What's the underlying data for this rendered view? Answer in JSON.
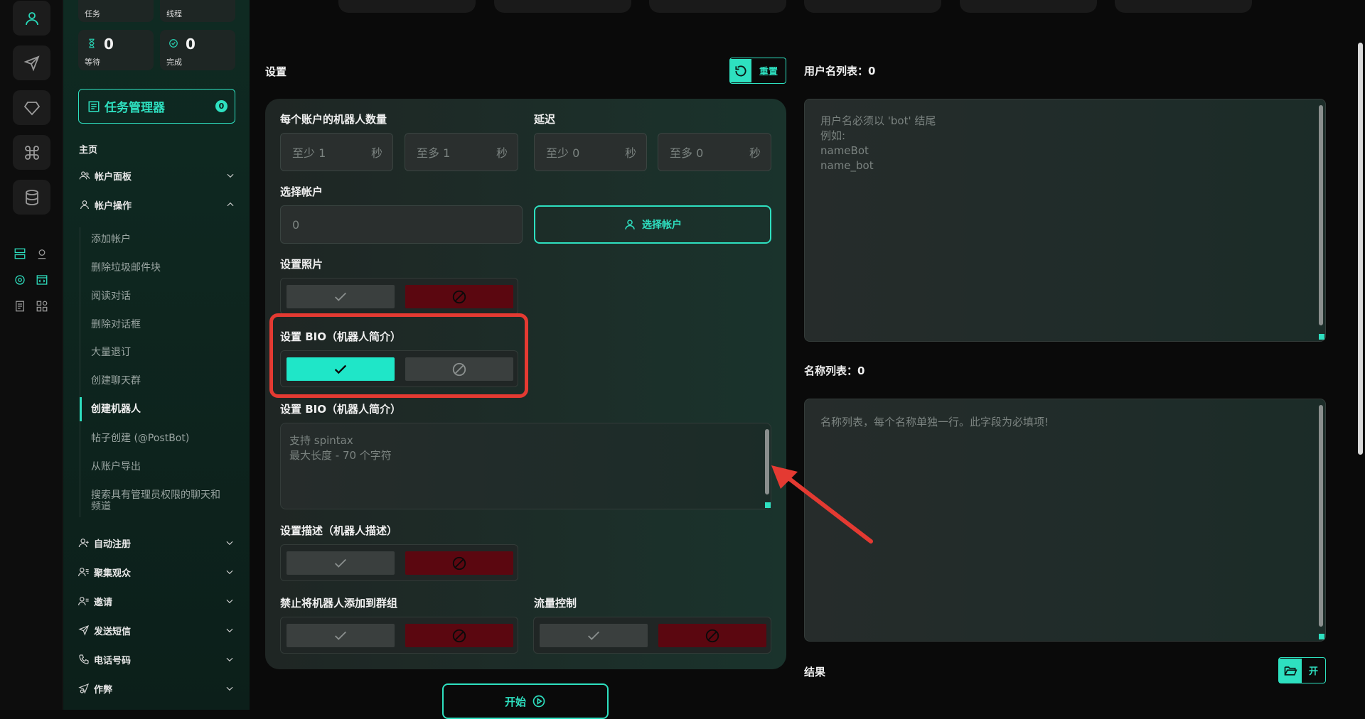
{
  "stats": {
    "tasks_label": "任务",
    "threads_label": "线程",
    "waiting_value": "0",
    "waiting_label": "等待",
    "done_value": "0",
    "done_label": "完成"
  },
  "sidebar": {
    "task_manager_label": "任务管理器",
    "task_manager_badge": "0",
    "main_section": "主页",
    "account_panel": "帐户面板",
    "account_ops": "帐户操作",
    "sub_items": [
      "添加帐户",
      "删除垃圾邮件块",
      "阅读对话",
      "删除对话框",
      "大量退订",
      "创建聊天群",
      "创建机器人",
      "帖子创建 (@PostBot)",
      "从账户导出",
      "搜索具有管理员权限的聊天和频道"
    ],
    "groups": [
      "自动注册",
      "聚集观众",
      "邀请",
      "发送短信",
      "电话号码",
      "作弊"
    ]
  },
  "settings": {
    "title": "设置",
    "reset_label": "重置",
    "bots_per_account_label": "每个账户的机器人数量",
    "delay_label": "延迟",
    "bots_min": "至少  1",
    "bots_max": "至多  1",
    "delay_min": "至少  0",
    "delay_max": "至多  0",
    "unit_seconds": "秒",
    "select_account_label": "选择帐户",
    "account_value": "0",
    "select_account_button": "选择帐户",
    "set_photo_label": "设置照片",
    "set_bio_toggle_label": "设置 BIO（机器人简介）",
    "set_bio_text_label": "设置 BIO（机器人简介）",
    "bio_placeholder_line1": "支持 spintax",
    "bio_placeholder_line2": "最大长度 - 70 个字符",
    "set_description_label": "设置描述（机器人描述）",
    "forbid_groups_label": "禁止将机器人添加到群组",
    "flow_control_label": "流量控制",
    "start_label": "开始"
  },
  "right": {
    "username_list_label": "用户名列表：0",
    "username_placeholder": [
      "用户名必须以 'bot' 结尾",
      "例如:",
      "nameBot",
      "name_bot"
    ],
    "name_list_label": "名称列表：0",
    "name_placeholder": "名称列表，每个名称单独一行。此字段为必填项!",
    "results_label": "结果",
    "open_label": "开"
  },
  "colors": {
    "accent": "#2ee0c0",
    "danger": "#5b0710",
    "highlight": "#e43a32"
  }
}
